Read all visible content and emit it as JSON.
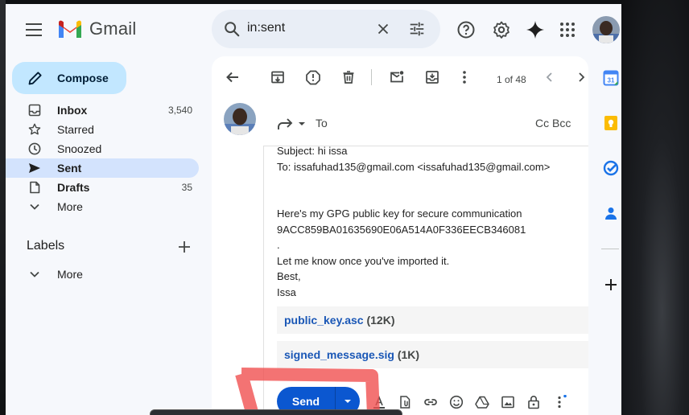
{
  "app": {
    "name": "Gmail"
  },
  "search": {
    "value": "in:sent"
  },
  "sidebar": {
    "compose_label": "Compose",
    "items": [
      {
        "label": "Inbox",
        "count": "3,540",
        "icon": "inbox-icon",
        "bold": true
      },
      {
        "label": "Starred",
        "count": "",
        "icon": "star-icon",
        "bold": false
      },
      {
        "label": "Snoozed",
        "count": "",
        "icon": "clock-icon",
        "bold": false
      },
      {
        "label": "Sent",
        "count": "",
        "icon": "send-icon",
        "bold": true,
        "active": true
      },
      {
        "label": "Drafts",
        "count": "35",
        "icon": "draft-icon",
        "bold": true
      },
      {
        "label": "More",
        "count": "",
        "icon": "chevron-down-icon",
        "bold": false
      }
    ],
    "labels_title": "Labels",
    "labels_more": "More"
  },
  "toolbar": {
    "pager": "1 of 48"
  },
  "reply": {
    "to_label": "To",
    "cc_bcc": "Cc Bcc"
  },
  "message": {
    "lines": [
      "Subject: hi issa",
      "To: issafuhad135@gmail.com <issafuhad135@gmail.com>",
      "",
      "",
      "Here's my GPG public key for secure communication",
      "9ACC859BA01635690E06A514A0F336EECB346081",
      ".",
      "Let me know once you've imported it.",
      "Best,",
      "Issa"
    ],
    "attachments": [
      {
        "name": "public_key.asc",
        "size": "(12K)"
      },
      {
        "name": "signed_message.sig",
        "size": "(1K)"
      }
    ]
  },
  "compose_actions": {
    "send_label": "Send"
  },
  "colors": {
    "accent": "#0b57d0",
    "compose_bg": "#c2e7ff",
    "active_nav": "#d3e3fd",
    "app_bg": "#f6f8fc"
  }
}
